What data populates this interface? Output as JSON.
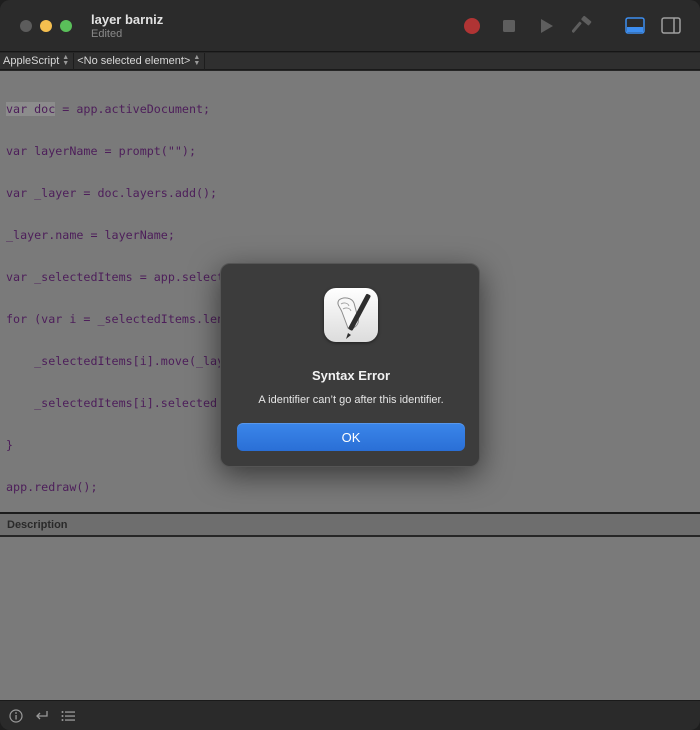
{
  "window": {
    "title": "layer barniz",
    "subtitle": "Edited"
  },
  "toolbar": {
    "record_icon": "record-icon",
    "stop_icon": "stop-icon",
    "run_icon": "run-icon",
    "compile_icon": "hammer-icon",
    "show_log_icon": "bottom-panel-icon",
    "show_sidebar_icon": "sidebar-icon",
    "record_color": "#cc3a3a"
  },
  "navbar": {
    "language": "AppleScript",
    "element": "<No selected element>"
  },
  "editor": {
    "lines": [
      "var doc = app.activeDocument;",
      "var layerName = prompt(\"\");",
      "var _layer = doc.layers.add();",
      "_layer.name = layerName;",
      "var _selectedItems = app.selection",
      "for (var i = _selectedItems.length - 1; i >= 0; i--) {",
      "    _selectedItems[i].move(_layer, ElementPlacement.PLACEATEND);",
      "    _selectedItems[i].selected = false;",
      "}",
      "app.redraw();"
    ],
    "highlighted_text": "var doc"
  },
  "description": {
    "label": "Description"
  },
  "bottombar": {
    "items": [
      "info-icon",
      "return-icon",
      "list-icon"
    ]
  },
  "dialog": {
    "icon": "script-editor-app-icon",
    "title": "Syntax Error",
    "message": "A identifier can’t go after this identifier.",
    "ok_label": "OK"
  }
}
